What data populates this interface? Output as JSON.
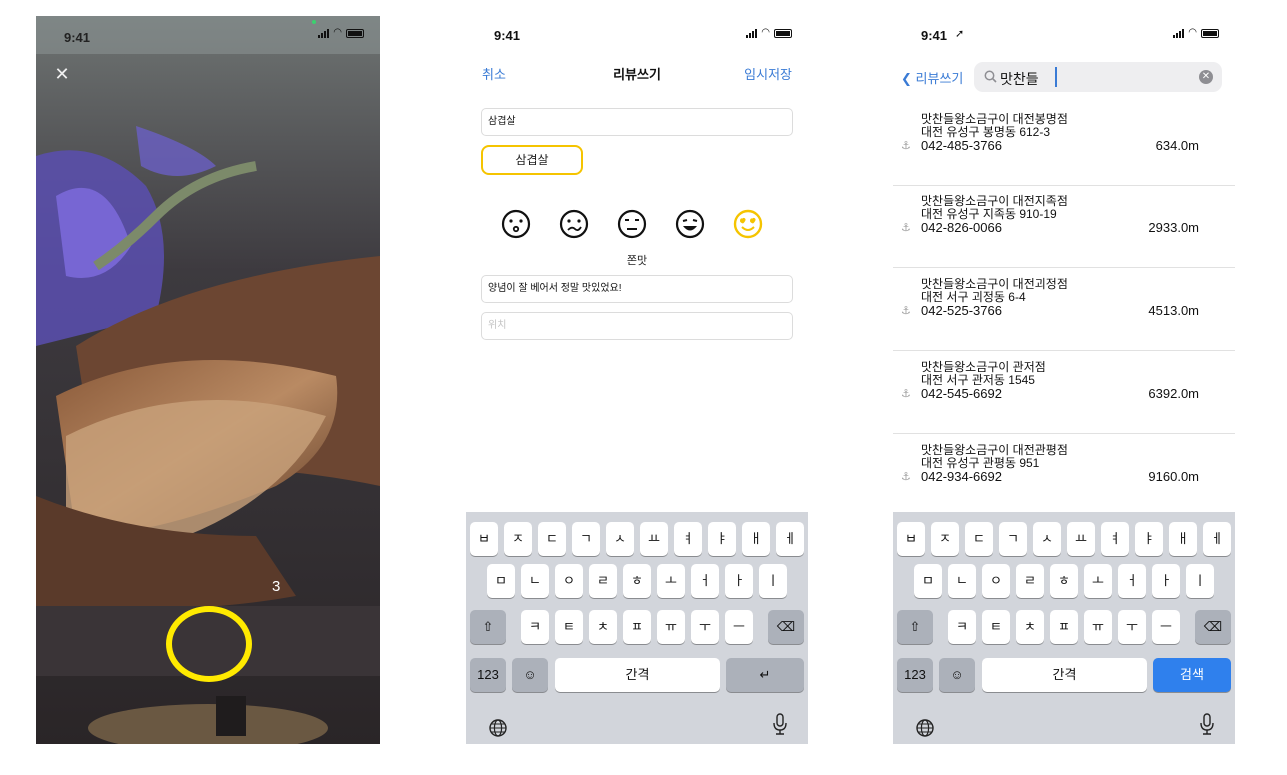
{
  "camera": {
    "status_time": "9:41",
    "close_symbol": "✕",
    "counter": "3",
    "shutter_color": "#ffea00"
  },
  "review": {
    "status_time": "9:41",
    "nav": {
      "cancel": "취소",
      "title": "리뷰쓰기",
      "draft": "임시저장"
    },
    "menu_input": "삼겹살",
    "menu_tag": "삼겹살",
    "faces": [
      "very-bad-face-icon",
      "bad-face-icon",
      "neutral-face-icon",
      "good-face-icon",
      "love-face-icon"
    ],
    "selected_face": "love-face-icon",
    "face_label": "쫀맛",
    "comment": "양념이 잘 베어서 정말 맛있었요!",
    "location_placeholder": "위치"
  },
  "search": {
    "status_time": "9:41",
    "back_label": "리뷰쓰기",
    "query": "맛찬들",
    "results": [
      {
        "name": "맛찬들왕소금구이 대전봉명점",
        "address": "대전 유성구 봉명동 612-3",
        "phone": "042-485-3766",
        "distance": "634.0m"
      },
      {
        "name": "맛찬들왕소금구이 대전지족점",
        "address": "대전 유성구 지족동 910-19",
        "phone": "042-826-0066",
        "distance": "2933.0m"
      },
      {
        "name": "맛찬들왕소금구이 대전괴정점",
        "address": "대전 서구 괴정동 6-4",
        "phone": "042-525-3766",
        "distance": "4513.0m"
      },
      {
        "name": "맛찬들왕소금구이 관저점",
        "address": "대전 서구 관저동 1545",
        "phone": "042-545-6692",
        "distance": "6392.0m"
      },
      {
        "name": "맛찬들왕소금구이 대전관평점",
        "address": "대전 유성구 관평동 951",
        "phone": "042-934-6692",
        "distance": "9160.0m"
      }
    ]
  },
  "keyboard": {
    "row1": [
      "ㅂ",
      "ㅈ",
      "ㄷ",
      "ㄱ",
      "ㅅ",
      "ㅛ",
      "ㅕ",
      "ㅑ",
      "ㅐ",
      "ㅔ"
    ],
    "row2": [
      "ㅁ",
      "ㄴ",
      "ㅇ",
      "ㄹ",
      "ㅎ",
      "ㅗ",
      "ㅓ",
      "ㅏ",
      "ㅣ"
    ],
    "row3": [
      "ㅋ",
      "ㅌ",
      "ㅊ",
      "ㅍ",
      "ㅠ",
      "ㅜ",
      "ㅡ"
    ],
    "shift": "⇧",
    "backspace": "⌫",
    "numbers": "123",
    "emoji": "☺",
    "space": "간격",
    "return": "↵",
    "search_return": "검색",
    "globe": "globe-icon",
    "mic": "mic-icon"
  },
  "colors": {
    "link": "#3a7bd5",
    "accent_yellow": "#f5c400",
    "search_key": "#2f80ed"
  }
}
